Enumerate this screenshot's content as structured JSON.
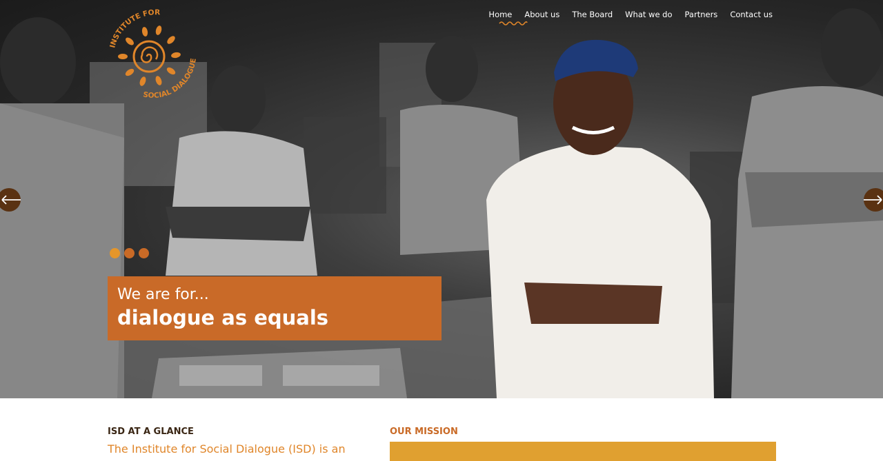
{
  "nav": {
    "items": [
      "Home",
      "About us",
      "The Board",
      "What we do",
      "Partners",
      "Contact us"
    ],
    "active_index": 0
  },
  "logo": {
    "top_text": "INSTITUTE FOR",
    "bottom_text": "SOCIAL DIALOGUE",
    "color": "#e0862a"
  },
  "slider": {
    "prev_icon": "arrow-left-icon",
    "next_icon": "arrow-right-icon",
    "slide_count": 3,
    "current_slide": 1
  },
  "hero": {
    "caption_small": "We are for...",
    "caption_big": "dialogue as equals"
  },
  "glance": {
    "title": "ISD AT A GLANCE",
    "text": "The Institute for Social Dialogue (ISD) is an"
  },
  "mission": {
    "title": "OUR MISSION"
  },
  "colors": {
    "accent": "#c96a28",
    "orange": "#e0862a",
    "gold": "#e0a030",
    "arrow_bg": "#5a3212",
    "dark_text": "#3a2614"
  }
}
